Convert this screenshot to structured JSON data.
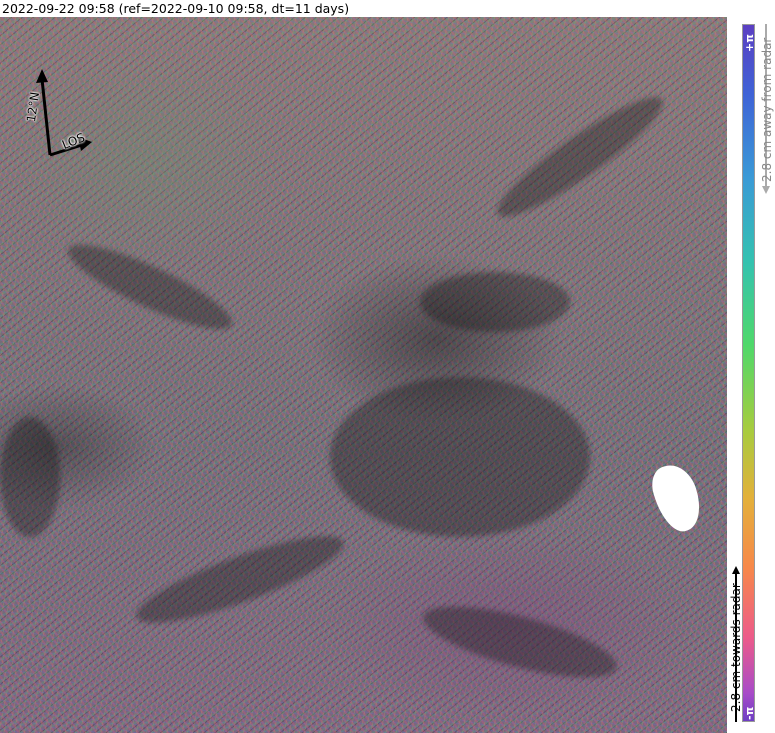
{
  "header": {
    "caption": "2022-09-22 09:58 (ref=2022-09-10 09:58, dt=11 days)"
  },
  "map": {
    "description_icon": "interferogram-phase-map",
    "compass": {
      "north_label": "12°N",
      "los_label": "LOS"
    },
    "no_data_color": "#ffffff"
  },
  "colorbar": {
    "top_label": "+π",
    "bottom_label": "-π",
    "away_text": "2.8 cm away from radar",
    "towards_text": "2.8 cm towards radar",
    "colors": [
      "#5b3fc2",
      "#3f63d6",
      "#3a9ad6",
      "#34c2b0",
      "#4fd86a",
      "#a6cc3f",
      "#e3b03a",
      "#f7884a",
      "#ec5b8a",
      "#6e3fc4"
    ]
  }
}
